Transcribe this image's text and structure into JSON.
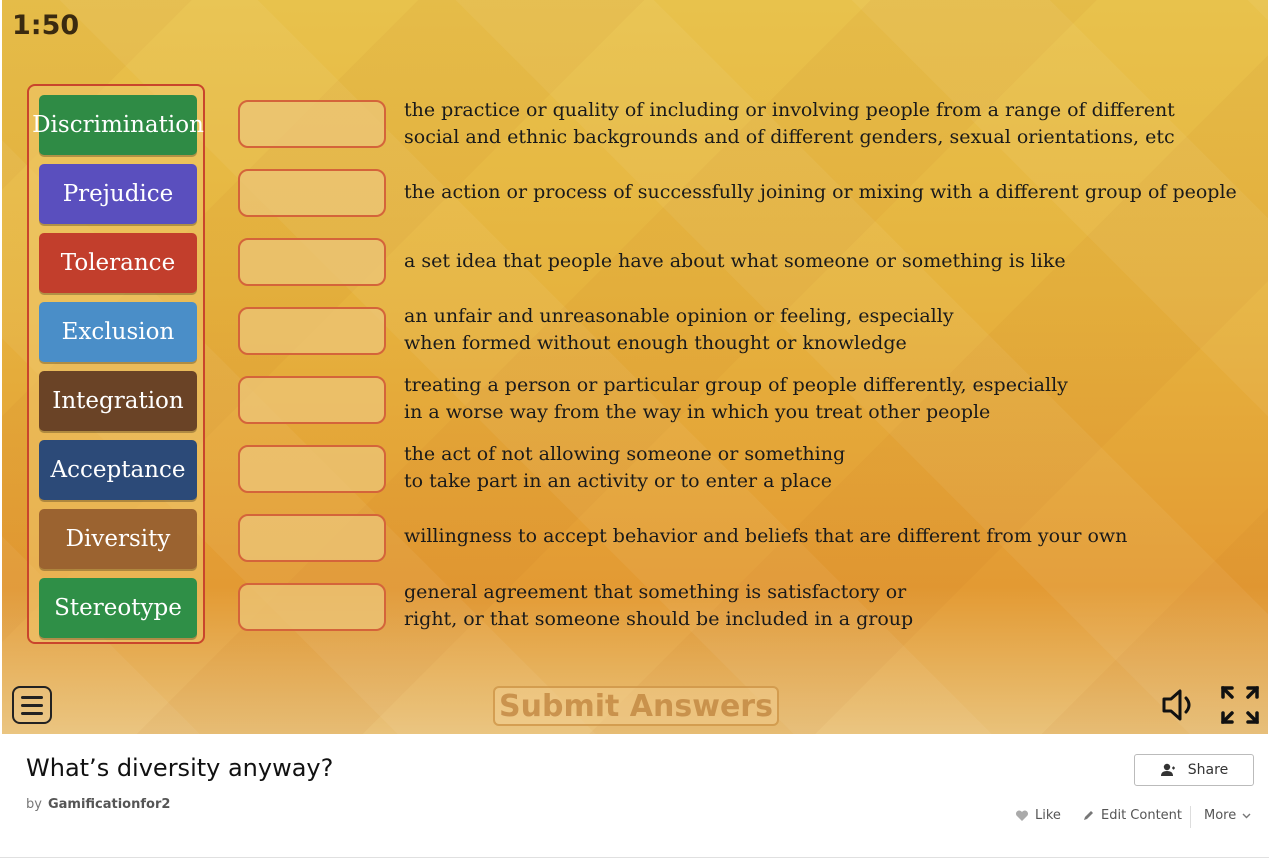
{
  "game": {
    "timer": "1:50",
    "terms": [
      {
        "label": "Discrimination",
        "color": "#2f8b45"
      },
      {
        "label": "Prejudice",
        "color": "#5a4fbe"
      },
      {
        "label": "Tolerance",
        "color": "#c23e2c"
      },
      {
        "label": "Exclusion",
        "color": "#4a8ec8"
      },
      {
        "label": "Integration",
        "color": "#6a4326"
      },
      {
        "label": "Acceptance",
        "color": "#2c4a78"
      },
      {
        "label": "Diversity",
        "color": "#9b6330"
      },
      {
        "label": "Stereotype",
        "color": "#2f8f47"
      }
    ],
    "definitions": [
      {
        "line1": "the practice or quality of including or involving people from a range of different",
        "line2": "social and ethnic backgrounds and of different genders, sexual orientations, etc"
      },
      {
        "line1": "the action or process of successfully joining or mixing with a different group of people",
        "line2": ""
      },
      {
        "line1": "a set idea that people have about what someone or something is like",
        "line2": ""
      },
      {
        "line1": "an unfair and unreasonable opinion or feeling, especially",
        "line2": "when formed without enough thought or knowledge"
      },
      {
        "line1": "treating a person or particular group of people differently, especially",
        "line2": "in a worse way from the way in which you treat other people"
      },
      {
        "line1": "the act of not allowing someone or something",
        "line2": "to take part in an activity or to enter a place"
      },
      {
        "line1": "willingness to accept behavior and beliefs that are different from your own",
        "line2": ""
      },
      {
        "line1": "general agreement that something is satisfactory or",
        "line2": "right, or that someone should be included in a group"
      }
    ],
    "submit_label": "Submit Answers",
    "icons": {
      "menu": "menu-icon",
      "sound": "speaker-icon",
      "fullscreen": "fullscreen-icon"
    }
  },
  "footer": {
    "title": "What’s diversity anyway?",
    "by_label": "by",
    "author": "Gamificationfor2",
    "share_label": "Share",
    "like_label": "Like",
    "edit_label": "Edit Content",
    "more_label": "More"
  }
}
